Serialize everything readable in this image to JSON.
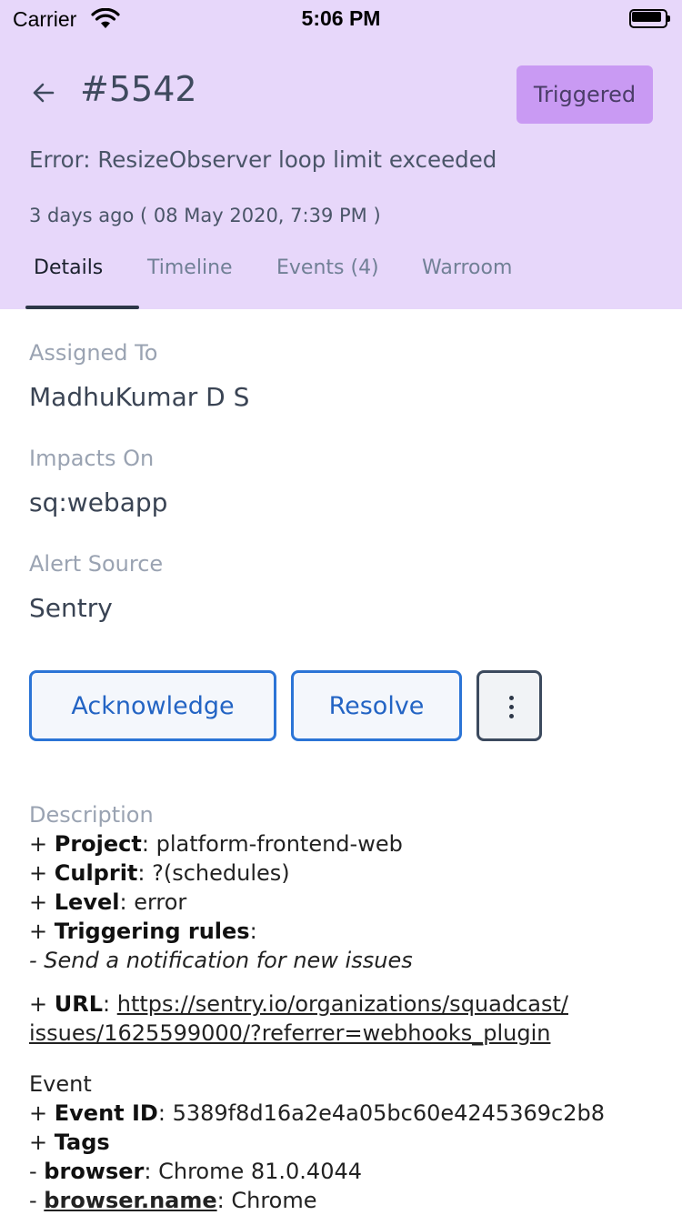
{
  "status_bar": {
    "carrier": "Carrier",
    "time": "5:06 PM"
  },
  "header": {
    "incident_id": "#5542",
    "status": "Triggered",
    "error": "Error: ResizeObserver loop limit exceeded",
    "time": "3 days ago ( 08 May 2020, 7:39 PM )",
    "colors": {
      "header_bg": "#e7d7fa",
      "status_bg": "#c99af3"
    }
  },
  "tabs": [
    {
      "label": "Details",
      "active": true
    },
    {
      "label": "Timeline",
      "active": false
    },
    {
      "label": "Events (4)",
      "active": false
    },
    {
      "label": "Warroom",
      "active": false
    }
  ],
  "details": {
    "assigned_to_label": "Assigned To",
    "assigned_to": "MadhuKumar D S",
    "impacts_on_label": "Impacts On",
    "impacts_on": "sq:webapp",
    "alert_source_label": "Alert Source",
    "alert_source": "Sentry"
  },
  "actions": {
    "acknowledge": "Acknowledge",
    "resolve": "Resolve",
    "more_icon": "more-vertical-icon",
    "accent": "#2b74d6"
  },
  "description": {
    "label": "Description",
    "plus": "+ ",
    "dash": "- ",
    "colon": ": ",
    "colon_only": ":",
    "project_key": "Project",
    "project_value": "platform-frontend-web",
    "culprit_key": "Culprit",
    "culprit_value": "?(schedules)",
    "level_key": "Level",
    "level_value": "error",
    "triggering_key": "Triggering rules",
    "rule": "Send a notification for new issues",
    "url_key": "URL",
    "url_line1": "https://sentry.io/organizations/squadcast/",
    "url_line2": "issues/1625599000/?referrer=webhooks_plugin",
    "event_heading": "Event",
    "event_id_key": "Event ID",
    "event_id_value": "5389f8d16a2e4a05bc60e4245369c2b8",
    "tags_key": "Tags",
    "browser_key": "browser",
    "browser_value": "Chrome 81.0.4044",
    "browser_name_key": "browser.name",
    "browser_name_value": "Chrome"
  }
}
